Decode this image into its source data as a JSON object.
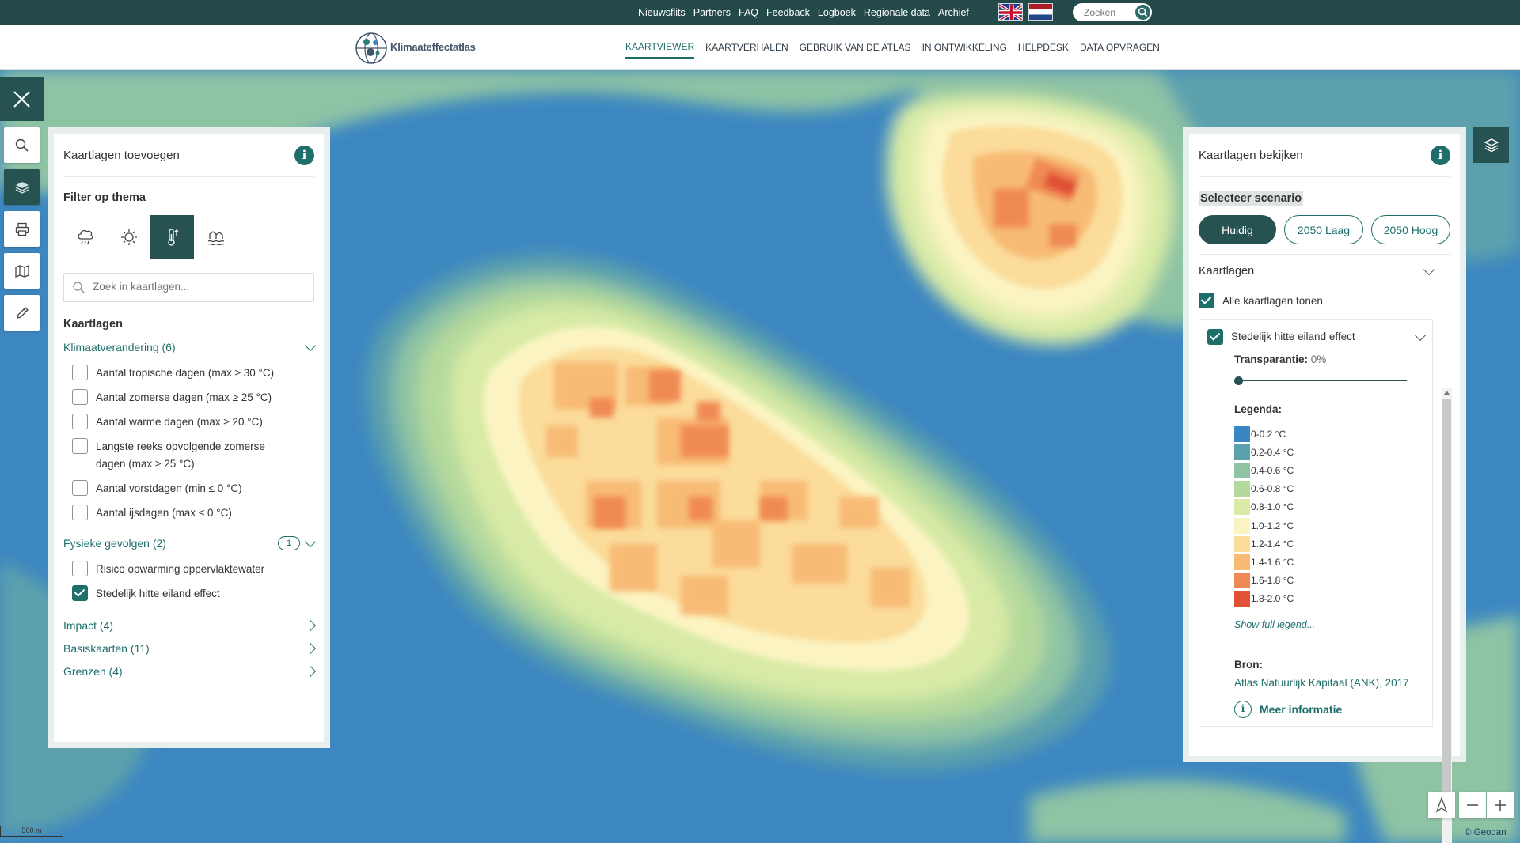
{
  "topbar": {
    "links": [
      "Nieuwsflits",
      "Partners",
      "FAQ",
      "Feedback",
      "Logboek",
      "Regionale data",
      "Archief"
    ],
    "search_placeholder": "Zoeken",
    "flags": [
      "flag-en",
      "flag-nl"
    ]
  },
  "nav": {
    "logo_text": "Klimaateffectatlas",
    "items": [
      "KAARTVIEWER",
      "KAARTVERHALEN",
      "GEBRUIK VAN DE ATLAS",
      "IN ONTWIKKELING",
      "HELPDESK",
      "DATA OPVRAGEN"
    ],
    "active": "KAARTVIEWER"
  },
  "left_panel": {
    "title": "Kaartlagen toevoegen",
    "filter_title": "Filter op thema",
    "theme_icons": [
      "rain-icon",
      "sun-icon",
      "thermometer-icon",
      "flood-icon"
    ],
    "active_theme": "thermometer-icon",
    "search_placeholder": "Zoek in kaartlagen...",
    "section_title": "Kaartlagen",
    "groups": [
      {
        "label": "Klimaatverandering (6)",
        "expanded": true,
        "items": [
          {
            "label": "Aantal tropische dagen (max ≥ 30 °C)",
            "checked": false
          },
          {
            "label": "Aantal zomerse dagen (max ≥ 25 °C)",
            "checked": false
          },
          {
            "label": "Aantal warme dagen (max ≥ 20 °C)",
            "checked": false
          },
          {
            "label": "Langste reeks opvolgende zomerse dagen (max ≥ 25 °C)",
            "checked": false
          },
          {
            "label": "Aantal vorstdagen (min ≤ 0 °C)",
            "checked": false
          },
          {
            "label": "Aantal ijsdagen (max ≤ 0 °C)",
            "checked": false
          }
        ]
      },
      {
        "label": "Fysieke gevolgen (2)",
        "badge": "1",
        "expanded": true,
        "items": [
          {
            "label": "Risico opwarming oppervlaktewater",
            "checked": false
          },
          {
            "label": "Stedelijk hitte eiland effect",
            "checked": true
          }
        ]
      },
      {
        "label": "Impact (4)",
        "expanded": false
      },
      {
        "label": "Basiskaarten (11)",
        "expanded": false
      },
      {
        "label": "Grenzen (4)",
        "expanded": false
      }
    ]
  },
  "right_panel": {
    "title": "Kaartlagen bekijken",
    "scenario_title": "Selecteer scenario",
    "scenarios": [
      "Huidig",
      "2050 Laag",
      "2050 Hoog"
    ],
    "active_scenario": "Huidig",
    "layers_title": "Kaartlagen",
    "show_all_label": "Alle kaartlagen tonen",
    "layer": {
      "name": "Stedelijk hitte eiland effect",
      "transparency_label": "Transparantie:",
      "transparency_value": "0%",
      "transparency_fraction": 0,
      "legend_title": "Legenda:",
      "legend": [
        {
          "label": "0-0.2 °C",
          "color": "#3a86c4"
        },
        {
          "label": "0.2-0.4 °C",
          "color": "#5ba0ad"
        },
        {
          "label": "0.4-0.6 °C",
          "color": "#8ec3a4"
        },
        {
          "label": "0.6-0.8 °C",
          "color": "#b4d99c"
        },
        {
          "label": "0.8-1.0 °C",
          "color": "#d9eba6"
        },
        {
          "label": "1.0-1.2 °C",
          "color": "#fbf4c2"
        },
        {
          "label": "1.2-1.4 °C",
          "color": "#fbdc9a"
        },
        {
          "label": "1.4-1.6 °C",
          "color": "#f8bb76"
        },
        {
          "label": "1.6-1.8 °C",
          "color": "#f08a55"
        },
        {
          "label": "1.8-2.0 °C",
          "color": "#e05136"
        }
      ],
      "show_full_legend": "Show full legend...",
      "source_label": "Bron:",
      "source": "Atlas Natuurlijk Kapitaal (ANK), 2017",
      "more_info": "Meer informatie"
    }
  },
  "map": {
    "scale_label": "500 m",
    "attribution": "© Geodan"
  },
  "colors": {
    "brand_dark": "#265251",
    "brand_accent": "#1e6f6b",
    "topbar": "#234a49",
    "water": "#3c87c0"
  }
}
